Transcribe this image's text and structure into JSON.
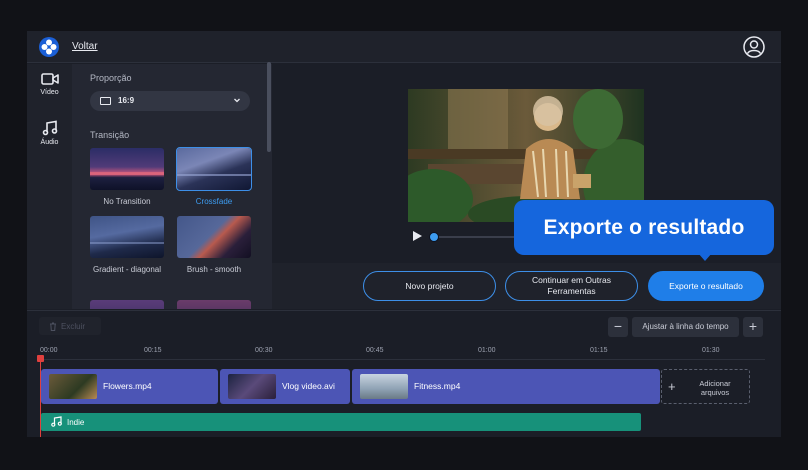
{
  "topbar": {
    "back_label": "Voltar"
  },
  "sidebar": {
    "items": [
      {
        "label": "Vídeo",
        "icon": "video-camera-icon"
      },
      {
        "label": "Áudio",
        "icon": "music-note-icon"
      }
    ]
  },
  "panel": {
    "aspect_label": "Proporção",
    "aspect_value": "16:9",
    "transition_label": "Transição",
    "transitions": [
      {
        "label": "No Transition",
        "selected": false
      },
      {
        "label": "Crossfade",
        "selected": true
      },
      {
        "label": "Gradient - diagonal",
        "selected": false
      },
      {
        "label": "Brush - smooth",
        "selected": false
      }
    ]
  },
  "callout": {
    "text": "Exporte o resultado"
  },
  "actions": {
    "new_project": "Novo projeto",
    "continue_other": "Continuar em Outras Ferramentas",
    "export": "Exporte o resultado"
  },
  "timeline": {
    "delete_label": "Excluir",
    "fit_label": "Ajustar à linha do tempo",
    "ruler": [
      "00:00",
      "00:15",
      "00:30",
      "00:45",
      "01:00",
      "01:15",
      "01:30"
    ],
    "clips": [
      {
        "name": "Flowers.mp4"
      },
      {
        "name": "Vlog video.avi"
      },
      {
        "name": "Fitness.mp4"
      }
    ],
    "add_files": "Adicionar arquivos",
    "audio": {
      "name": "Indie"
    }
  },
  "colors": {
    "accent": "#1f7ee8",
    "clip": "#4c55b5",
    "audio": "#17917a",
    "playhead": "#e0403e"
  }
}
